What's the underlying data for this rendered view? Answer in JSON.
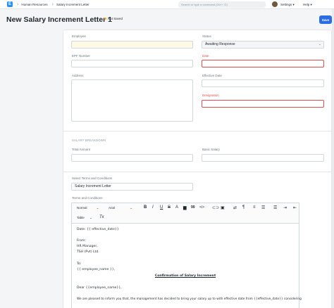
{
  "navbar": {
    "logo": "E",
    "breadcrumbs": [
      "Human Resources",
      "Salary Increment Letter"
    ],
    "search_placeholder": "Search or type a command (Ctrl + G)",
    "settings_label": "Settings",
    "help_label": "Help"
  },
  "page": {
    "title": "New Salary Increment Letter 1",
    "status": "Not Saved",
    "save_label": "Save"
  },
  "form": {
    "employee_label": "Employee",
    "employee_value": "",
    "status_label": "Status",
    "status_value": "Awaiting Response",
    "epf_label": "EPF Number",
    "date_label": "Date",
    "address_label": "Address",
    "effective_date_label": "Effective Date",
    "designation_label": "Designation",
    "salary_breakdown_heading": "SALARY BREAKDOWN",
    "total_amount_label": "Total Amount",
    "basic_salary_label": "Basic Salary",
    "terms_select_label": "Select Terms and Conditions",
    "terms_select_value": "Salary Increment Letter",
    "terms_label": "Terms and Conditions"
  },
  "editor": {
    "toolbar": {
      "style": "Normal",
      "font": "Arial",
      "bold": "B",
      "italic": "I",
      "underline": "U",
      "strike": "S",
      "quote": "99",
      "code": "</>",
      "table": "Table",
      "clear": "Tx"
    },
    "lines": [
      "Date: {{ effective_date}}",
      "From:",
      "HR Manager,",
      "TSH (Pvt) Ltd.",
      "To:",
      "{{ employee_name }},",
      "Dear {{employee_name}},",
      "We are pleased to inform you that, the management has decided to bring your salary up to with effective date from {{effective_date}} considering"
    ],
    "heading": "Confirmation of Salary Increment"
  }
}
